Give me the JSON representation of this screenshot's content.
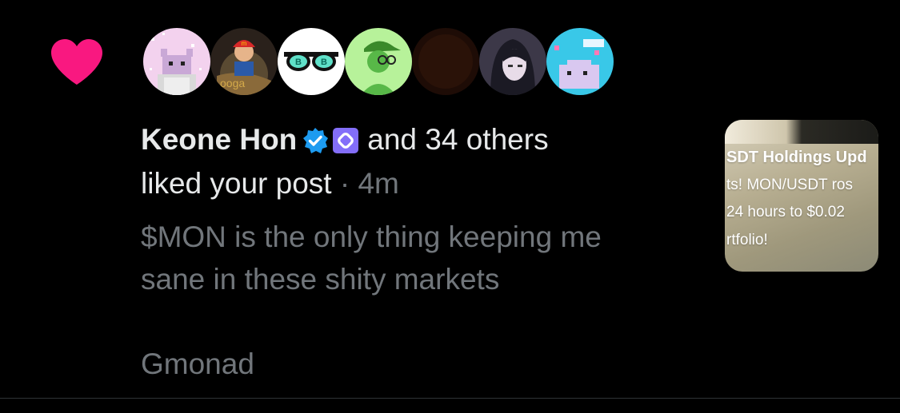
{
  "notification": {
    "type": "like",
    "heart_color": "#f91880",
    "avatars": [
      {
        "icon": "pixel-cat-avatar"
      },
      {
        "icon": "cartoon-man-red-cap-avatar"
      },
      {
        "icon": "sunglasses-avatar"
      },
      {
        "icon": "green-character-avatar"
      },
      {
        "icon": "dark-brown-avatar"
      },
      {
        "icon": "anime-girl-avatar"
      },
      {
        "icon": "pixel-creature-avatar"
      }
    ],
    "user_name": "Keone Hon",
    "verified_badge_color": "#1d9bf0",
    "affiliate_badge_color": "#836ef9",
    "others_text": "and 34 others",
    "action_text": "liked your post",
    "separator": "·",
    "time": "4m",
    "post_text": "$MON is the only thing keeping me\nsane in these shity markets\n\nGmonad",
    "media_card": {
      "line1": "SDT Holdings Upd",
      "line2": "ts! MON/USDT ros",
      "line3": " 24 hours to $0.02",
      "line4": "rtfolio!"
    }
  }
}
